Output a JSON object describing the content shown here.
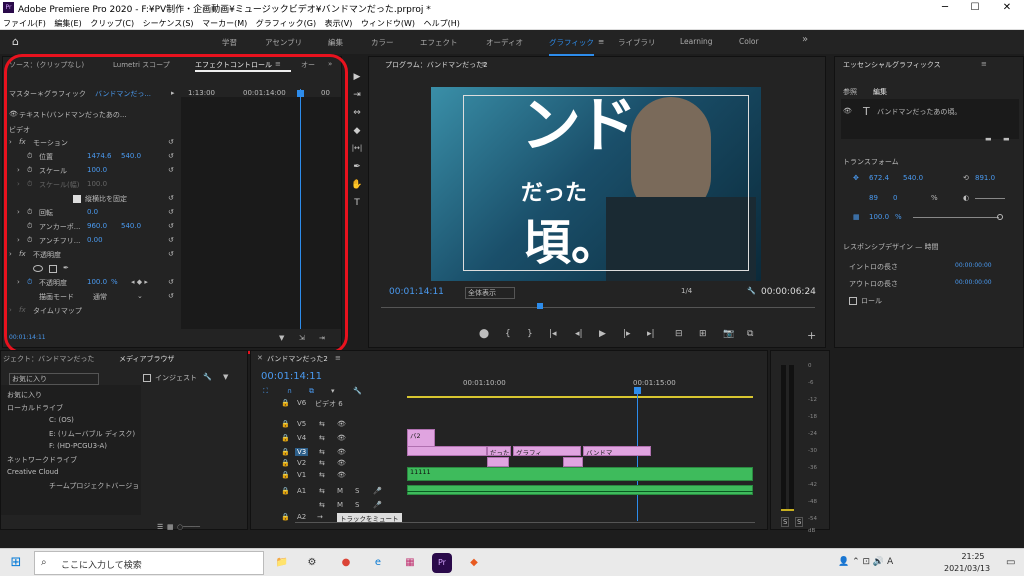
{
  "titlebar": {
    "title": "Adobe Premiere Pro 2020 - F:¥PV制作・企画動画¥ミュージックビデオ¥バンドマンだった.prproj *",
    "minimize": "─",
    "maximize": "☐",
    "close": "✕",
    "logo": "Pr"
  },
  "menu": [
    "ファイル(F)",
    "編集(E)",
    "クリップ(C)",
    "シーケンス(S)",
    "マーカー(M)",
    "グラフィック(G)",
    "表示(V)",
    "ウィンドウ(W)",
    "ヘルプ(H)"
  ],
  "workspaces": [
    "学習",
    "アセンブリ",
    "編集",
    "カラー",
    "エフェクト",
    "オーディオ",
    "グラフィック",
    "ライブラリ",
    "Learning",
    "Color"
  ],
  "workspace_active": "グラフィック",
  "ws_overflow": "≡",
  "ws_more": "»",
  "effect_panel": {
    "tabs": [
      "ソース：(クリップなし)",
      "Lumetri スコープ",
      "エフェクトコントロール",
      "オー"
    ],
    "tab_menu": "≡",
    "master": "マスター＊グラフィック",
    "sequence": "バンドマンだっ...",
    "timecodes": [
      "1:13:00",
      "00:01:14:00",
      "00"
    ],
    "text_layer": "テキスト(バンドマンだったあの...",
    "video_label": "ビデオ",
    "motion": "モーション",
    "position_label": "位置",
    "position_x": "1474.6",
    "position_y": "540.0",
    "scale_label": "スケール",
    "scale_val": "100.0",
    "scale_w_label": "スケール(幅)",
    "scale_w_val": "100.0",
    "uniform": "縦横比を固定",
    "rotation_label": "回転",
    "rotation_val": "0.0",
    "anchor_label": "アンカーポ...",
    "anchor_x": "960.0",
    "anchor_y": "540.0",
    "antiflicker_label": "アンチフリ...",
    "antiflicker_val": "0.00",
    "opacity_section": "不透明度",
    "opacity_label": "不透明度",
    "opacity_val": "100.0",
    "opacity_unit": "%",
    "blend_label": "描画モード",
    "blend_val": "通常",
    "timeremap": "タイムリマップ",
    "current_time": "00:01:14:11"
  },
  "program": {
    "title": "プログラム：バンドマンだった2",
    "menu": "≡",
    "timecode": "00:01:14:11",
    "fit": "全体表示",
    "quality": "1/4",
    "duration": "00:00:06:24",
    "overlay_big": "ンド",
    "overlay_mid": "だった",
    "overlay_bottom": "頃。"
  },
  "essential": {
    "title": "エッセンシャルグラフィックス",
    "menu": "≡",
    "tabs": [
      "参照",
      "編集"
    ],
    "layer": "バンドマンだったあの頃。",
    "transform": "トランスフォーム",
    "pos_x": "672.4",
    "pos_y": "540.0",
    "rot": "891.0",
    "anchor_x": "89",
    "anchor_y": "0",
    "scale": "100.0",
    "pct": "%",
    "responsive": "レスポンシブデザイン — 時間",
    "intro": "イントロの長さ",
    "intro_val": "00:00:00:00",
    "outro": "アウトロの長さ",
    "outro_val": "00:00:00:00",
    "roll": "ロール"
  },
  "project": {
    "tabs": [
      "ジェクト：バンドマンだった",
      "メディアブラウザ"
    ],
    "favorites_dd": "お気に入り",
    "ingest": "インジェスト",
    "items": [
      "お気に入り",
      "ローカルドライブ",
      "C: (OS)",
      "E: (リムーバブル ディスク)",
      "F: (HD-PCGU3-A)",
      "ネットワークドライブ",
      "Creative Cloud",
      "チームプロジェクトバージョ"
    ]
  },
  "timeline": {
    "title": "バンドマンだった2",
    "menu": "≡",
    "timecode": "00:01:14:11",
    "ruler": [
      "00:01:10:00",
      "00:01:15:00"
    ],
    "tracks": [
      "V6",
      "V5",
      "V4",
      "V3",
      "V2",
      "V1",
      "A1",
      "",
      "A2"
    ],
    "v6_name": "ビデオ 6",
    "clips": [
      {
        "label": "バ2"
      },
      {
        "label": "だった"
      },
      {
        "label": "グラフィ"
      },
      {
        "label": "バンドマ"
      },
      {
        "label": "11111"
      }
    ],
    "toggle": "M",
    "solo": "S",
    "tooltip": "トラックをミュート",
    "meter_ticks": [
      "0",
      "-6",
      "-12",
      "-18",
      "-24",
      "-30",
      "-36",
      "-42",
      "-48",
      "-54",
      "dB"
    ],
    "meter_solo": "S"
  },
  "taskbar": {
    "search": "ここに入力して検索",
    "time": "21:25",
    "date": "2021/03/13",
    "apps": [
      "ps",
      "📁",
      "⚙",
      "●",
      "e",
      "▦",
      "Pr",
      "◆"
    ]
  },
  "tools": [
    "▶",
    "⇥",
    "⇔",
    "◆",
    "|↔|",
    "✒",
    "✋",
    "T"
  ],
  "colors": {
    "accent": "#2d8ceb",
    "annotation": "#e8121e"
  }
}
